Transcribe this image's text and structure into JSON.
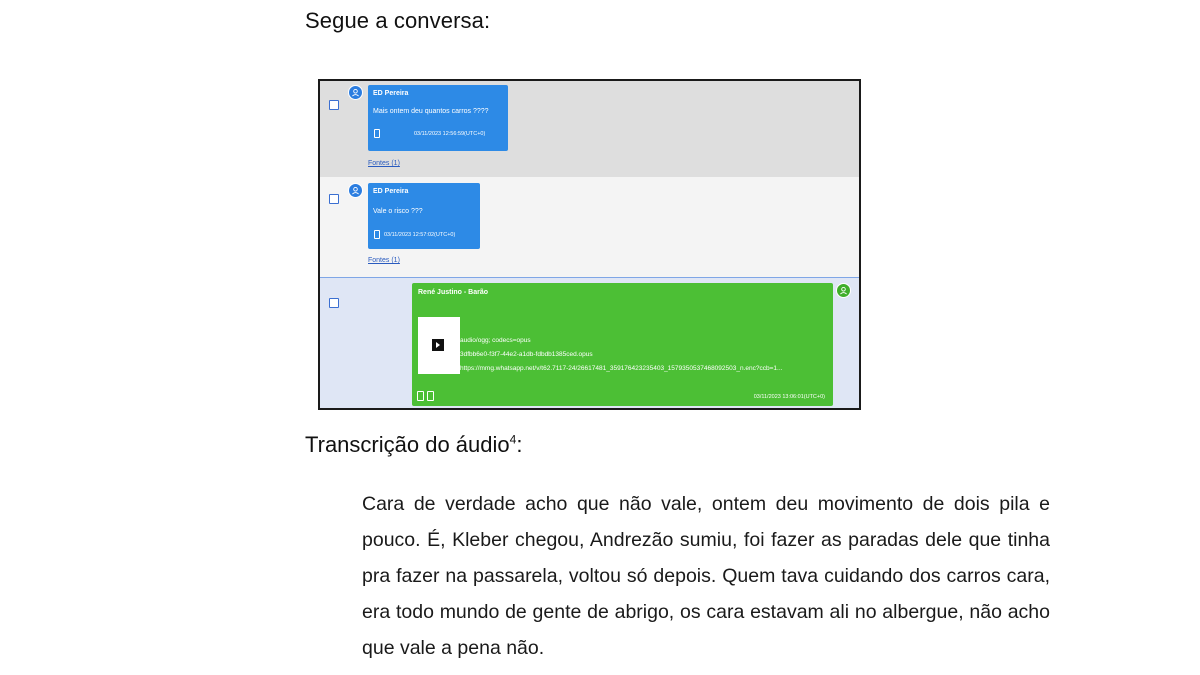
{
  "intro": "Segue a conversa:",
  "messages": [
    {
      "sender": "ED Pereira",
      "text": "Mais ontem deu quantos carros ????",
      "timestamp": "03/11/2023 12:56:59(UTC+0)",
      "sources": "Fontes (1)"
    },
    {
      "sender": "ED Pereira",
      "text": "Vale o risco ???",
      "timestamp": "03/11/2023 12:57:02(UTC+0)",
      "sources": "Fontes (1)"
    },
    {
      "sender": "René Justino - Barão",
      "mime": "audio/ogg; codecs=opus",
      "filename": "3dfbb6e0-f3f7-44e2-a1db-fdbdb1385ced.opus",
      "url": "https://mmg.whatsapp.net/v/t62.7117-24/26617481_359176423235403_1579350537468092503_n.enc?ccb=1...",
      "timestamp": "03/11/2023 13:06:01(UTC+0)"
    }
  ],
  "transcricao_label": "Transcrição do áudio",
  "footnote": "4",
  "transcript": "Cara de verdade acho que não vale, ontem deu movimento de dois pila e pouco. É, Kleber chegou, Andrezão sumiu, foi fazer as paradas dele que tinha pra fazer na passarela, voltou só depois. Quem tava cuidando dos carros cara, era todo mundo de gente de abrigo, os cara estavam ali no albergue, não acho que vale a pena não.",
  "colors": {
    "blue_bubble": "#2d8ae6",
    "green_bubble": "#4cbf35",
    "link": "#2a5bbf"
  }
}
